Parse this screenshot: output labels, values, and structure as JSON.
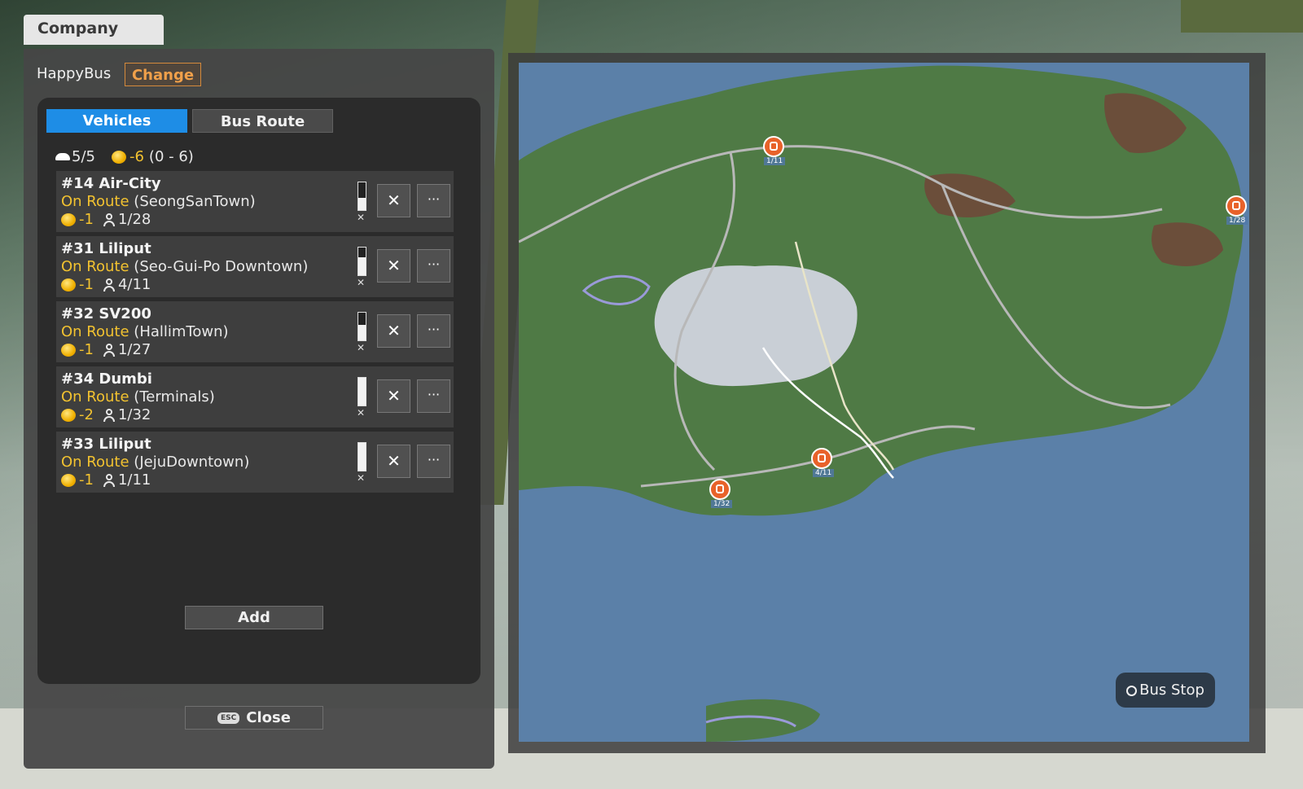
{
  "company_tab": {
    "label": "Company"
  },
  "company": {
    "name": "HappyBus",
    "change_label": "Change"
  },
  "tabs": [
    {
      "label": "Vehicles",
      "active": true
    },
    {
      "label": "Bus Route",
      "active": false
    }
  ],
  "summary": {
    "vehicles": "5/5",
    "money": "-6",
    "range": "(0 - 6)"
  },
  "vehicles": [
    {
      "title": "#14 Air-City",
      "status": "On Route",
      "route": "(SeongSanTown)",
      "money": "-1",
      "passengers": "1/28",
      "fuel": 0.45
    },
    {
      "title": "#31 Liliput",
      "status": "On Route",
      "route": "(Seo-Gui-Po Downtown)",
      "money": "-1",
      "passengers": "4/11",
      "fuel": 0.65
    },
    {
      "title": "#32 SV200",
      "status": "On Route",
      "route": "(HallimTown)",
      "money": "-1",
      "passengers": "1/27",
      "fuel": 0.55
    },
    {
      "title": "#34 Dumbi",
      "status": "On Route",
      "route": "(Terminals)",
      "money": "-2",
      "passengers": "1/32",
      "fuel": 1.0
    },
    {
      "title": "#33 Liliput",
      "status": "On Route",
      "route": "(JejuDowntown)",
      "money": "-1",
      "passengers": "1/11",
      "fuel": 1.0
    }
  ],
  "add_label": "Add",
  "close": {
    "key": "ESC",
    "label": "Close"
  },
  "map": {
    "bus_stop_label": "Bus Stop",
    "markers": [
      {
        "label": "1/11"
      },
      {
        "label": "1/28"
      },
      {
        "label": "4/11"
      },
      {
        "label": "1/32"
      }
    ]
  },
  "colors": {
    "accent_blue": "#1e8de6",
    "money_yellow": "#f2c230",
    "change_orange": "#f0a04a",
    "sea": "#5b80a8",
    "land": "#4f7a45"
  }
}
